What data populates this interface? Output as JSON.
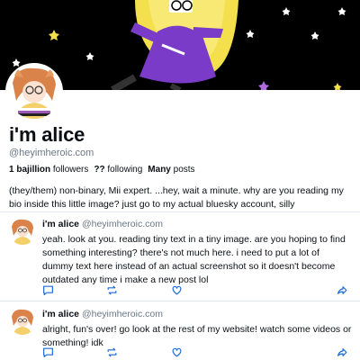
{
  "profile": {
    "display_name": "i'm alice",
    "handle": "@heyimheroic.com",
    "followers_count": "1 bajillion",
    "followers_label": "followers",
    "following_count": "??",
    "following_label": "following",
    "posts_count": "Many",
    "posts_label": "posts",
    "bio": "(they/them) non-binary, Mii expert. ...hey, wait a minute. why are you reading my bio inside this little image? just go to my actual bluesky account, silly"
  },
  "posts": [
    {
      "name": "i'm alice",
      "handle": "@heyimheroic.com",
      "text": "yeah. look at you. reading tiny text in a tiny image. are you hoping to find something interesting? there's not much here. i need to put a lot of dummy text here instead of an actual screenshot so it doesn't become outdated any time i make a new post lol"
    },
    {
      "name": "i'm alice",
      "handle": "@heyimheroic.com",
      "text": "alright, fun's over! go look at the rest of my website! watch some videos or something! idk"
    }
  ],
  "icons": {
    "reply": "speech-bubble-icon",
    "repost": "repost-arrows-icon",
    "like": "heart-icon",
    "share": "share-arrow-icon"
  },
  "colors": {
    "banner": "#000000",
    "accent_moon": "#f4e04d",
    "accent_purple": "#7a3cc8",
    "icon_blue": "#1e6ad8",
    "muted_text": "#6b7785"
  }
}
